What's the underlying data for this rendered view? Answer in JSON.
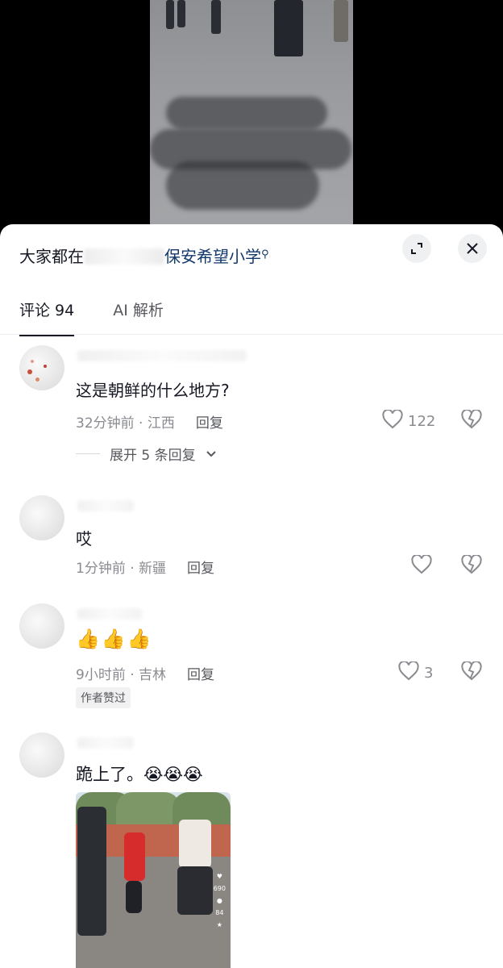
{
  "sheet": {
    "title_prefix": "大家都在",
    "title_link": "保安希望小学",
    "search_icon": "🔍"
  },
  "buttons": {
    "expand_icon": "expand-icon",
    "close_icon": "close-icon"
  },
  "tabs": [
    {
      "label": "评论 94",
      "active": true
    },
    {
      "label": "AI 解析",
      "active": false
    }
  ],
  "comments": [
    {
      "text": "这是朝鲜的什么地方?",
      "time_location": "32分钟前 · 江西",
      "reply_label": "回复",
      "likes": "122",
      "expand_label": "展开 5 条回复"
    },
    {
      "text": "哎",
      "time_location": "1分钟前 · 新疆",
      "reply_label": "回复",
      "likes": ""
    },
    {
      "text": "👍👍👍",
      "time_location": "9小时前 · 吉林",
      "reply_label": "回复",
      "likes": "3",
      "badge": "作者赞过"
    },
    {
      "text": "跪上了。😭😭😭",
      "thumbnail_counts": [
        "690",
        "84"
      ]
    }
  ]
}
